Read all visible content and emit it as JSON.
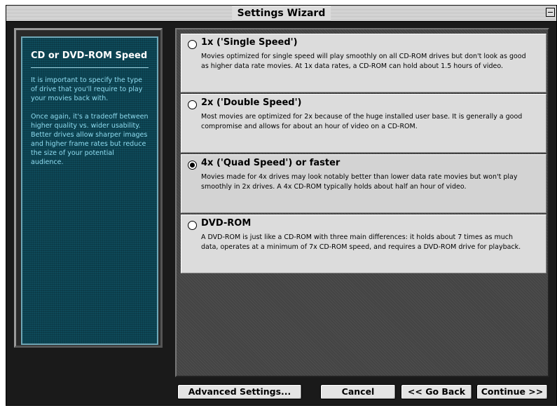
{
  "window": {
    "title": "Settings Wizard"
  },
  "sidebar": {
    "heading": "CD or DVD-ROM Speed",
    "paragraphs": [
      "It is important to specify the type of drive that you'll require to play your movies back with.",
      "Once again, it's a tradeoff between higher quality vs. wider usability. Better drives allow sharper images and higher frame rates but reduce the size of your potential audience."
    ]
  },
  "options": [
    {
      "title": "1x ('Single Speed')",
      "description": "Movies optimized for single speed will play smoothly on all CD-ROM drives but don't look as good as higher data rate movies. At 1x data rates, a CD-ROM can hold about 1.5 hours of video.",
      "selected": false
    },
    {
      "title": "2x ('Double Speed')",
      "description": "Most movies are optimized for 2x because of the huge installed user base. It is generally a good compromise and allows for about an hour of video on a CD-ROM.",
      "selected": false
    },
    {
      "title": "4x ('Quad Speed') or faster",
      "description": "Movies made for 4x drives may look notably better than lower data rate movies but won't play smoothly in 2x drives. A 4x CD-ROM typically holds about half an hour of video.",
      "selected": true
    },
    {
      "title": "DVD-ROM",
      "description": "A DVD-ROM is just like a CD-ROM with three main differences: it holds about 7 times as much data, operates at a minimum of 7x CD-ROM speed, and requires a DVD-ROM drive for playback.",
      "selected": false
    }
  ],
  "buttons": {
    "advanced": "Advanced Settings...",
    "cancel": "Cancel",
    "back": "<< Go Back",
    "continue": "Continue >>"
  }
}
